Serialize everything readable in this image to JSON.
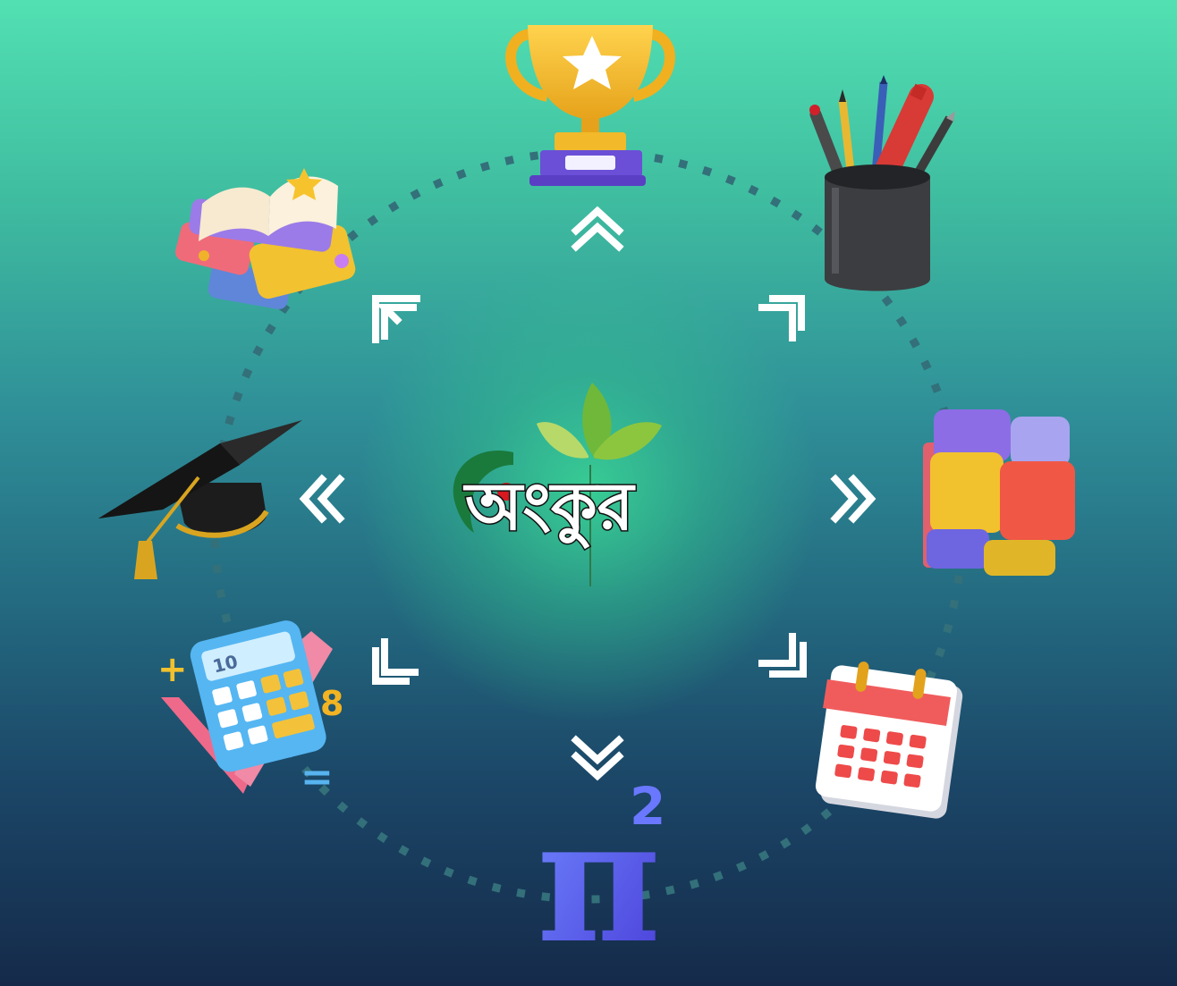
{
  "logo": {
    "wordmark": "অংকুর",
    "accent_color": "#d71920",
    "leaf_color": "#8cc63f",
    "ring_color": "#1a7a3c"
  },
  "colors": {
    "background_top": "#52e0b2",
    "background_bottom": "#152a4a",
    "arrow": "#ffffff",
    "dotted_ring": "#33707a"
  },
  "calculator": {
    "display": "10",
    "symbols": [
      "+",
      "8",
      "="
    ]
  },
  "pi_symbol": {
    "glyph": "π",
    "exponent": "2"
  },
  "icons": [
    "trophy-icon",
    "pencil-cup-icon",
    "cube-icon",
    "calendar-icon",
    "pi-squared-icon",
    "calculator-icon",
    "graduation-cap-icon",
    "books-icon"
  ]
}
